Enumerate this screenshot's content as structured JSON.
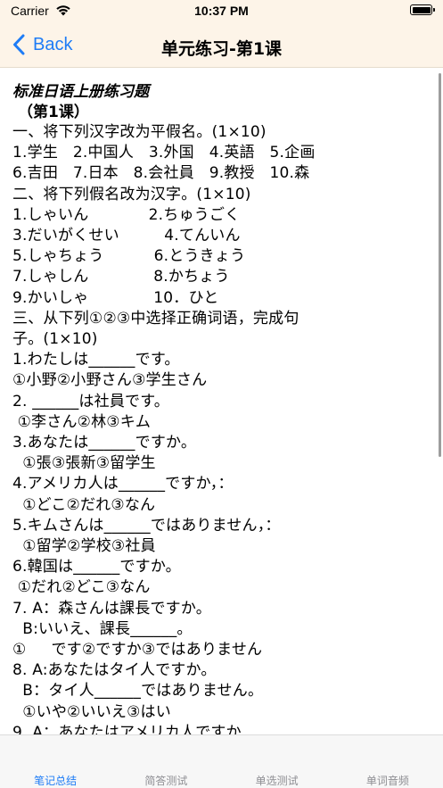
{
  "status_bar": {
    "carrier": "Carrier",
    "time": "10:37 PM"
  },
  "nav": {
    "back_label": "Back",
    "title": "单元练习-第1课"
  },
  "document": {
    "title": "标准日语上册练习题",
    "lesson": "（第1课）",
    "lines": [
      "一、将下列汉字改为平假名。(1×10)",
      "1.学生   2.中国人   3.外国   4.英語   5.企画",
      "6.吉田   7.日本   8.会社員   9.教授   10.森",
      "二、将下列假名改为汉字。(1×10)",
      "1.しゃいん            2.ちゅうごく",
      "3.だいがくせい         4.てんいん",
      "5.しゃちょう          6.とうきょう",
      "7.しゃしん             8.かちょう",
      "9.かいしゃ             10．ひと",
      "三、从下列①②③中选择正确词语，完成句",
      "子。(1×10)",
      "1.わたしは______です。",
      "①小野②小野さん③学生さん",
      "2. ______は社員です。",
      " ①李さん②林③キム",
      "3.あなたは______ですか。",
      "  ①張③張新③留学生",
      "4.アメリカ人は______ですか，：",
      "  ①どこ②だれ③なん",
      "5.キムさんは______ではありません，：",
      "  ①留学②学校③社員",
      "6.韓国は______ですか。",
      " ①だれ②どこ③なん",
      "7. A：森さんは課長ですか。",
      "  B:いいえ、課長______。",
      "①     です②ですか③ではありません",
      "8. A:あなたはタイ人ですか。",
      "  B：タイ人______ではありません。",
      "  ①いや②いいえ③はい",
      "9. A：あなたはアメリカ人ですか"
    ]
  },
  "tabs": [
    {
      "label": "笔记总结",
      "active": true
    },
    {
      "label": "简答测试",
      "active": false
    },
    {
      "label": "单选测试",
      "active": false
    },
    {
      "label": "单词音频",
      "active": false
    }
  ],
  "colors": {
    "accent": "#1e7cf6",
    "bar_background": "#fdf4e8"
  },
  "icons": {
    "back": "chevron-left-icon",
    "wifi": "wifi-icon",
    "battery": "battery-icon"
  }
}
